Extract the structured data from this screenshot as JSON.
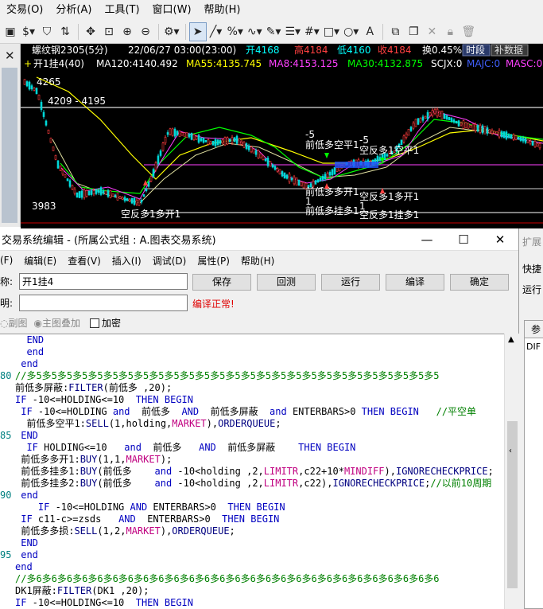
{
  "menubar": {
    "items": [
      "交易(O)",
      "分析(A)",
      "工具(T)",
      "窗口(W)",
      "帮助(H)"
    ]
  },
  "toolbar": {
    "icons": [
      "new-window-icon",
      "dollar-icon",
      "filter-icon",
      "chart-swap-icon",
      "move-icon",
      "zoom-fit-icon",
      "zoom-in-icon",
      "zoom-out-icon",
      "gear-icon",
      "pointer-icon",
      "line-icon",
      "percent-icon",
      "wave-icon",
      "pen-icon",
      "bracket-icon",
      "grid-icon",
      "rect-icon",
      "circle-icon",
      "text-icon",
      "window-icon",
      "copy-icon",
      "delete-icon",
      "lock-icon",
      "trash-icon"
    ]
  },
  "chart": {
    "header_line1": {
      "symbol": "螺纹钢2305(5分)",
      "datetime": "22/06/27 03:00(23:00)",
      "open": "开4168",
      "high": "高4184",
      "low": "低4160",
      "close": "收4184",
      "change": "换0.45%",
      "btn_period": "时段",
      "btn_supplement": "补数据"
    },
    "header_line2": {
      "name": "开1挂4(40)",
      "ma120": "MA120:4140.492",
      "ma55": "MA55:4135.745",
      "ma8": "MA8:4153.125",
      "ma30": "MA30:4132.875",
      "scjx": "SCJX:0",
      "majc": "MAJC:0",
      "masc": "MASC:0"
    },
    "price_high": "4265",
    "price_mid": "4209 - 4195",
    "price_low": "3983",
    "annotations": {
      "a1": "空反多1多开1",
      "a2": "-5",
      "a3": "前低多空平1",
      "a4": "-5",
      "a5": "空反多1空平1",
      "a6": "前低多多开1",
      "a7": "前低多挂多1",
      "a8": "空反多1多开1",
      "a9": "空反多1挂多1",
      "a10": "1",
      "a11": "1"
    },
    "colors": {
      "up": "#ff3b3b",
      "down": "#00d8d8",
      "ma120": "#ffff00",
      "ma55": "#ffff00",
      "ma8": "#ff00ff",
      "ma30": "#00ff00"
    }
  },
  "editor": {
    "title": "交易系统编辑 - (所属公式组 : A.图表交易系统)",
    "menus": [
      "(F)",
      "编辑(E)",
      "查看(V)",
      "插入(I)",
      "调试(D)",
      "属性(P)",
      "帮助(H)"
    ],
    "name_label": "称:",
    "name_value": "开1挂4",
    "desc_label": "明:",
    "desc_value": "",
    "status": "编译正常!",
    "buttons": {
      "save": "保存",
      "undo": "回测",
      "run": "运行",
      "edit": "编译",
      "ok": "确定"
    },
    "radio_sub": "副图",
    "radio_main": "主图叠加",
    "checkbox_encrypt": "加密",
    "line_numbers": [
      "80",
      "85",
      "90",
      "95"
    ]
  },
  "code_lines": [
    "  END",
    "  end",
    " end",
    "//多5多5多5多5多5多5多5多5多5多5多5多5多5多5多5多5多5多5多5多5多5多5多5多5多5多5多5",
    "前低多屏蔽:FILTER(前低多 ,20);",
    "IF -10<=HOLDING<=10  THEN BEGIN",
    " IF -10<=HOLDING and  前低多  AND  前低多屏蔽  and ENTERBARS>0 THEN BEGIN   //平空单",
    "  前低多空平1:SELL(1,holding,MARKET),ORDERQUEUE;",
    " END",
    "  IF HOLDING<=10   and  前低多   AND  前低多屏蔽    THEN BEGIN",
    " 前低多多开1:BUY(1,1,MARKET);",
    " 前低多挂多1:BUY(前低多    and -10<holding ,2,LIMITR,c22+10*MINDIFF),IGNORECHECKPRICE;",
    " 前低多挂多2:BUY(前低多    and -10<holding ,2,LIMITR,c22),IGNORECHECKPRICE;//以前10周期",
    " end",
    "    IF -10<=HOLDING AND ENTERBARS>0  THEN BEGIN",
    " IF c11-c>=zsds   AND  ENTERBARS>0  THEN BEGIN",
    " 前低多多损:SELL(1,2,MARKET),ORDERQUEUE;",
    " END",
    " end",
    "end",
    "//多6多6多6多6多6多6多6多6多6多6多6多6多6多6多6多6多6多6多6多6多6多6多6多6多6多6多6",
    "DK1屏蔽:FILTER(DK1 ,20);",
    "IF -10<=HOLDING<=10  THEN BEGIN"
  ],
  "right_panel": {
    "t1": "扩展",
    "t2": "快捷",
    "t3": "运行",
    "col": "参",
    "row": "DIF"
  }
}
